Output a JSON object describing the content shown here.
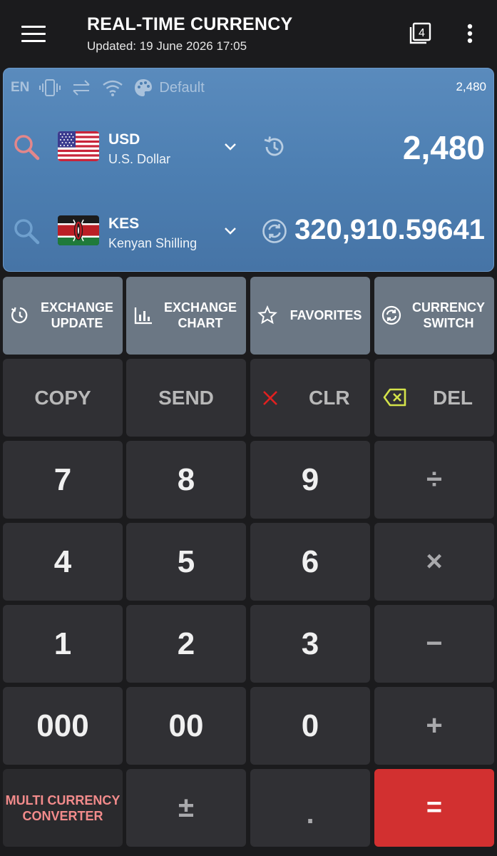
{
  "header": {
    "title": "REAL-TIME CURRENCY",
    "subtitle": "Updated: 19 June 2026 17:05",
    "tab_count": "4"
  },
  "status_bar": {
    "language": "EN",
    "theme_label": "Default",
    "mini_amount": "2,480"
  },
  "from_currency": {
    "code": "USD",
    "name": "U.S. Dollar",
    "amount": "2,480"
  },
  "to_currency": {
    "code": "KES",
    "name": "Kenyan Shilling",
    "amount": "320,910.59641"
  },
  "functions": [
    {
      "line1": "EXCHANGE",
      "line2": "UPDATE"
    },
    {
      "line1": "EXCHANGE",
      "line2": "CHART"
    },
    {
      "line1": "FAVORITES",
      "line2": ""
    },
    {
      "line1": "CURRENCY",
      "line2": "SWITCH"
    }
  ],
  "keys": {
    "copy": "COPY",
    "send": "SEND",
    "clr": "CLR",
    "del": "DEL",
    "k7": "7",
    "k8": "8",
    "k9": "9",
    "divide": "÷",
    "k4": "4",
    "k5": "5",
    "k6": "6",
    "multiply": "×",
    "k1": "1",
    "k2": "2",
    "k3": "3",
    "minus": "−",
    "k000": "000",
    "k00": "00",
    "k0": "0",
    "plus": "+",
    "multi_line1": "MULTI CURRENCY",
    "multi_line2": "CONVERTER",
    "plusminus": "±",
    "dot": ".",
    "equals": "="
  },
  "colors": {
    "panel": "#4c7eb1",
    "function_button": "#6b7784",
    "key": "#303034",
    "equals": "#d23030",
    "clear_x": "#e02020",
    "delete_icon": "#d4e34a",
    "multi_converter_text": "#f28b8b"
  }
}
